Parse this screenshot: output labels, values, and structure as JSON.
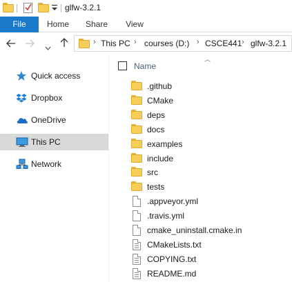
{
  "window": {
    "title": "glfw-3.2.1"
  },
  "ribbon": {
    "tabs": [
      "File",
      "Home",
      "Share",
      "View"
    ]
  },
  "address": {
    "crumbs": [
      "This PC",
      "courses (D:)",
      "CSCE441",
      "glfw-3.2.1"
    ]
  },
  "navpane": {
    "items": [
      {
        "label": "Quick access",
        "icon": "star-icon"
      },
      {
        "label": "Dropbox",
        "icon": "dropbox-icon"
      },
      {
        "label": "OneDrive",
        "icon": "cloud-icon"
      },
      {
        "label": "This PC",
        "icon": "computer-icon",
        "selected": true
      },
      {
        "label": "Network",
        "icon": "network-icon"
      }
    ]
  },
  "filelist": {
    "column_name": "Name",
    "items": [
      {
        "name": ".github",
        "type": "folder"
      },
      {
        "name": "CMake",
        "type": "folder"
      },
      {
        "name": "deps",
        "type": "folder"
      },
      {
        "name": "docs",
        "type": "folder"
      },
      {
        "name": "examples",
        "type": "folder"
      },
      {
        "name": "include",
        "type": "folder"
      },
      {
        "name": "src",
        "type": "folder"
      },
      {
        "name": "tests",
        "type": "folder"
      },
      {
        "name": ".appveyor.yml",
        "type": "file"
      },
      {
        "name": ".travis.yml",
        "type": "file"
      },
      {
        "name": "cmake_uninstall.cmake.in",
        "type": "file"
      },
      {
        "name": "CMakeLists.txt",
        "type": "text"
      },
      {
        "name": "COPYING.txt",
        "type": "text"
      },
      {
        "name": "README.md",
        "type": "text"
      }
    ]
  },
  "colors": {
    "accent": "#1979ca",
    "folder": "#f7cf58",
    "selected": "#d9d9d9"
  }
}
